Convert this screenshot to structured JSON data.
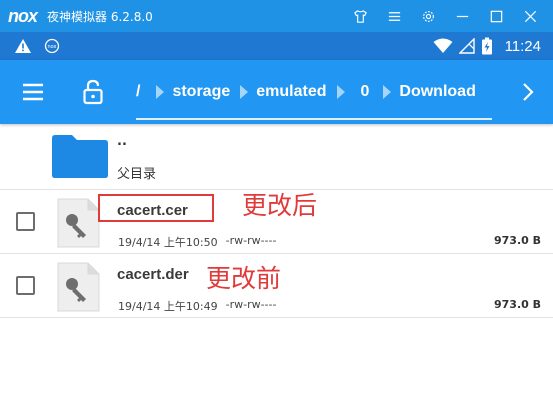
{
  "emulator": {
    "logo": "nox",
    "title": "夜神模拟器 6.2.8.0"
  },
  "status_bar": {
    "time": "11:24"
  },
  "toolbar": {
    "breadcrumbs": [
      "/",
      "storage",
      "emulated",
      "0",
      "Download"
    ]
  },
  "parent_entry": {
    "dots": "..",
    "label": "父目录"
  },
  "files": [
    {
      "name": "cacert.cer",
      "date": "19/4/14 上午10:50",
      "perms": "-rw-rw----",
      "size": "973.0 B"
    },
    {
      "name": "cacert.der",
      "date": "19/4/14 上午10:49",
      "perms": "-rw-rw----",
      "size": "973.0 B"
    }
  ],
  "annotations": {
    "after": "更改后",
    "before": "更改前"
  },
  "colors": {
    "emulator_bar": "#1f92e6",
    "status_bar": "#1f78d1",
    "toolbar": "#2196f3",
    "folder": "#1e88e5",
    "annotation": "#e03a3a"
  }
}
